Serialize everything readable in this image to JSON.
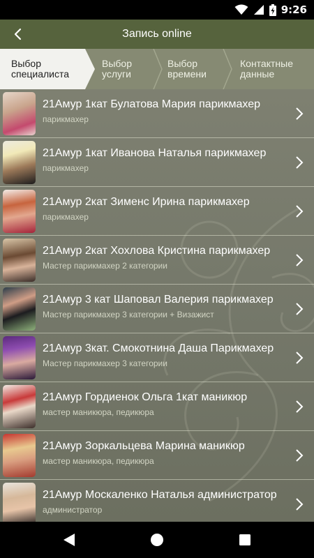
{
  "status_bar": {
    "time": "9:26"
  },
  "app_bar": {
    "title": "Запись online"
  },
  "steps": [
    {
      "label": "Выбор\nспециалиста",
      "active": true
    },
    {
      "label": "Выбор\nуслуги",
      "active": false
    },
    {
      "label": "Выбор\nвремени",
      "active": false
    },
    {
      "label": "Контактные\nданные",
      "active": false
    }
  ],
  "specialists": [
    {
      "name": "21Амур 1кат Булатова Мария парикмахер",
      "role": "парикмахер"
    },
    {
      "name": "21Амур 1кат Иванова Наталья парикмахер",
      "role": "парикмахер"
    },
    {
      "name": "21Амур 2кат Зименс Ирина парикмахер",
      "role": "парикмахер"
    },
    {
      "name": "21Амур 2кат Хохлова Кристина парикмахер",
      "role": "Мастер парикмахер 2 категории"
    },
    {
      "name": "21Амур 3 кат Шаповал Валерия парикмахер",
      "role": "Мастер парикмахер 3 категории + Визажист"
    },
    {
      "name": "21Амур 3кат. Смокотнина Даша Парикмахер",
      "role": "Мастер парикмахер 3 категории"
    },
    {
      "name": "21Амур Гордиенок Ольга 1кат маникюр",
      "role": "мастер маникюра, педикюра"
    },
    {
      "name": "21Амур Зоркальцева Марина маникюр",
      "role": "мастер маникюра, педикюра"
    },
    {
      "name": "21Амур Москаленко Наталья администратор",
      "role": "администратор"
    }
  ],
  "colors": {
    "app_bar": "#56633d",
    "steps_bar": "#868a73",
    "step_active": "#f2f2ee",
    "list_bg": "#75786a"
  },
  "icons": {
    "back": "arrow-back-icon",
    "row_chevron": "chevron-right-icon",
    "nav_back": "triangle-back-icon",
    "nav_home": "circle-home-icon",
    "nav_recents": "square-recents-icon"
  }
}
